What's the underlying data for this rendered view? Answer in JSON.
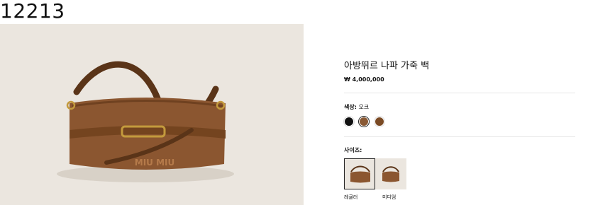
{
  "page": {
    "id_label": "12213"
  },
  "product": {
    "title": "아방뛰르 나파 가죽 백",
    "price": "₩ 4,000,000",
    "image_logo": "MIU MIU",
    "color": {
      "label": "색상:",
      "selected": "오크",
      "swatches": [
        {
          "name": "black",
          "hex": "#111111"
        },
        {
          "name": "oak",
          "hex": "#8a5a35",
          "selected": true
        },
        {
          "name": "brown",
          "hex": "#7a4a24"
        }
      ]
    },
    "size": {
      "label": "사이즈:",
      "options": [
        {
          "label": "레귤러",
          "selected": true
        },
        {
          "label": "미디엄",
          "selected": false
        }
      ]
    }
  }
}
